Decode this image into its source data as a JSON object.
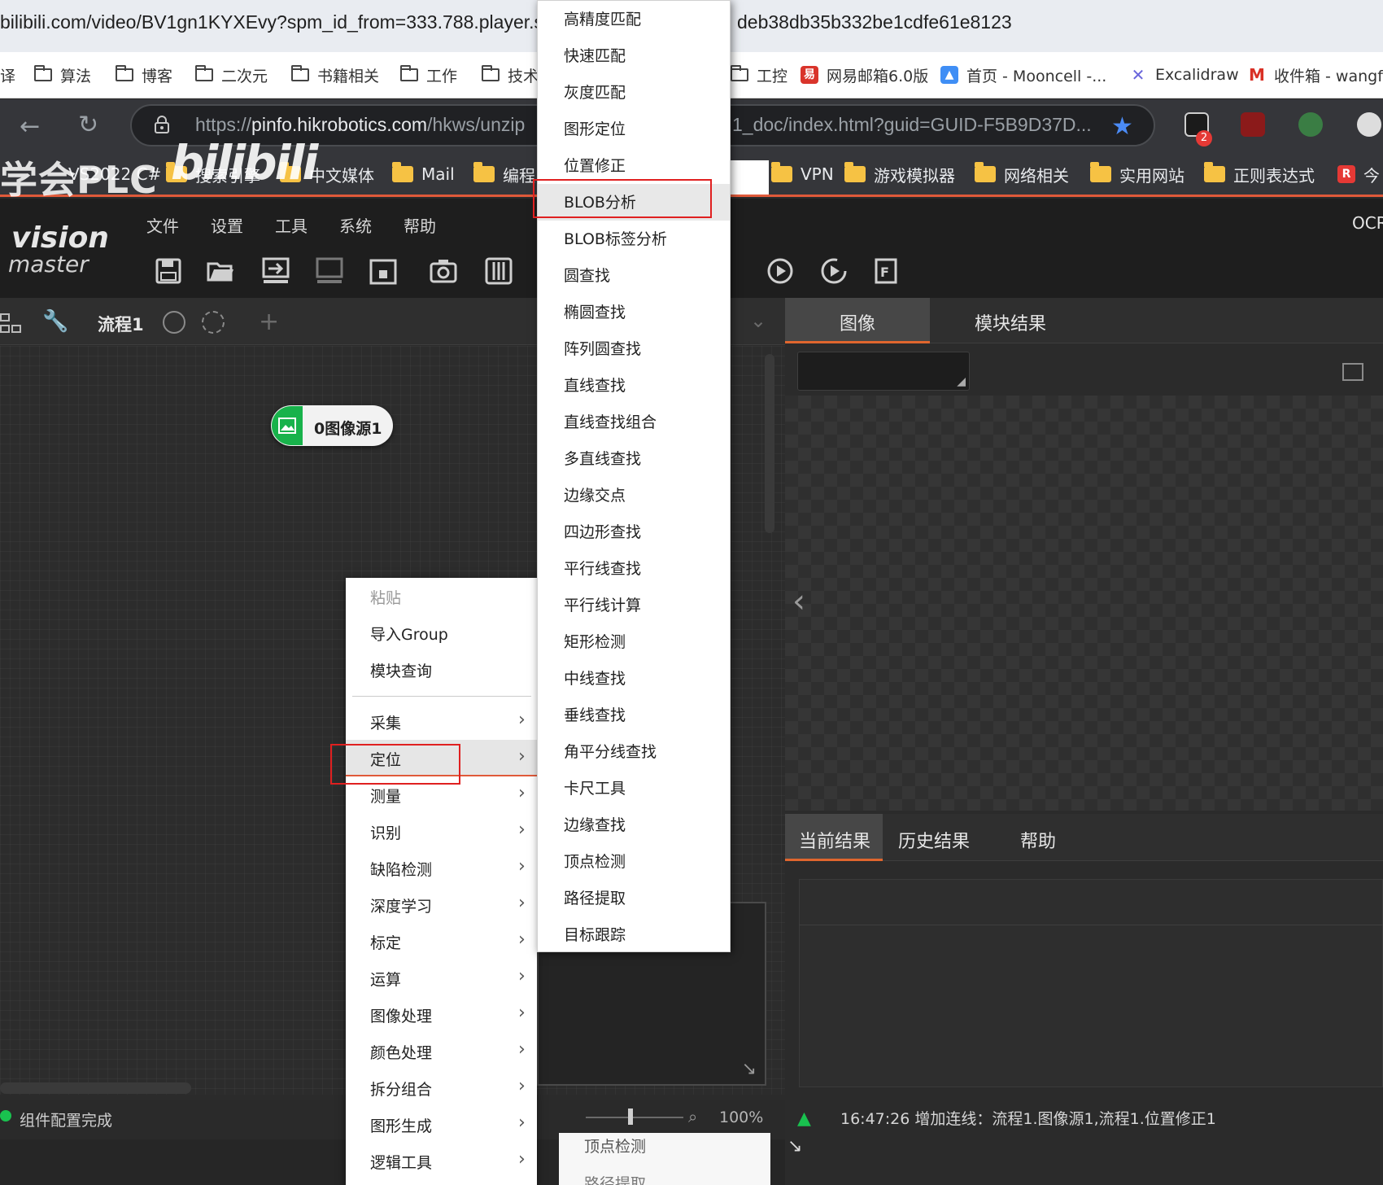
{
  "outer_browser": {
    "url_left": "bilibili.com/video/BV1gn1KYXEvy?spm_id_from=333.788.player.swi",
    "url_right": "deb38db35b332be1cdfe61e8123",
    "bookmarks": [
      {
        "label": "译",
        "icon": "folder-icon"
      },
      {
        "label": "算法",
        "icon": "folder-icon"
      },
      {
        "label": "博客",
        "icon": "folder-icon"
      },
      {
        "label": "二次元",
        "icon": "folder-icon"
      },
      {
        "label": "书籍相关",
        "icon": "folder-icon"
      },
      {
        "label": "工作",
        "icon": "folder-icon"
      },
      {
        "label": "技术",
        "icon": "folder-icon"
      },
      {
        "label": "工控",
        "icon": "folder-icon"
      },
      {
        "label": "网易邮箱6.0版",
        "icon": "netease-mail-icon"
      },
      {
        "label": "首页 - Mooncell -...",
        "icon": "mooncell-icon"
      },
      {
        "label": "Excalidraw",
        "icon": "excalidraw-icon"
      },
      {
        "label": "收件箱 - wangfe",
        "icon": "gmail-icon"
      }
    ]
  },
  "inner_browser": {
    "url_prefix": "https://",
    "url_host": "pinfo.hikrobotics.com",
    "url_path": "/hkws/unzip",
    "url_tail": "1_doc/index.html?guid=GUID-F5B9D37D...",
    "extension_badge": "2",
    "bookmarks": [
      {
        "label": "VS2022 C#"
      },
      {
        "label": "搜索引擎"
      },
      {
        "label": "中文媒体"
      },
      {
        "label": "Mail"
      },
      {
        "label": "编程"
      },
      {
        "label": "VPN"
      },
      {
        "label": "游戏模拟器"
      },
      {
        "label": "网络相关"
      },
      {
        "label": "实用网站"
      },
      {
        "label": "正则表达式"
      },
      {
        "label": "今"
      }
    ],
    "watermark": "学会PLC",
    "bili_logo": "bilibili"
  },
  "app": {
    "logo_line1": "vision",
    "logo_line2": "master",
    "menus": [
      "文件",
      "设置",
      "工具",
      "系统",
      "帮助"
    ],
    "ocr_label": "OCR",
    "flow_tab": "流程1",
    "add_tab": "+",
    "node_label": "0图像源1",
    "status_text": "组件配置完成",
    "zoom": "100%",
    "right_tabs": [
      "图像",
      "模块结果"
    ],
    "result_tabs": [
      "当前结果",
      "历史结果",
      "帮助"
    ],
    "log": "16:47:26  增加连线：流程1.图像源1,流程1.位置修正1"
  },
  "context_menu": {
    "top_items": [
      {
        "label": "粘贴",
        "disabled": true
      },
      {
        "label": "导入Group",
        "disabled": false
      },
      {
        "label": "模块查询",
        "disabled": false
      }
    ],
    "category_items": [
      "采集",
      "定位",
      "测量",
      "识别",
      "缺陷检测",
      "深度学习",
      "标定",
      "运算",
      "图像处理",
      "颜色处理",
      "拆分组合",
      "图形生成",
      "逻辑工具"
    ],
    "active": "定位"
  },
  "submenu": {
    "items": [
      "高精度匹配",
      "快速匹配",
      "灰度匹配",
      "图形定位",
      "位置修正",
      "BLOB分析",
      "BLOB标签分析",
      "圆查找",
      "椭圆查找",
      "阵列圆查找",
      "直线查找",
      "直线查找组合",
      "多直线查找",
      "边缘交点",
      "四边形查找",
      "平行线查找",
      "平行线计算",
      "矩形检测",
      "中线查找",
      "垂线查找",
      "角平分线查找",
      "卡尺工具",
      "边缘查找",
      "顶点检测",
      "路径提取",
      "目标跟踪"
    ],
    "active": "BLOB分析"
  },
  "ghost_menu": [
    "顶点检测",
    "路径提取"
  ],
  "colors": {
    "highlight_box": "#e02020",
    "accent": "#e0662e",
    "node_green": "#18b24b"
  }
}
